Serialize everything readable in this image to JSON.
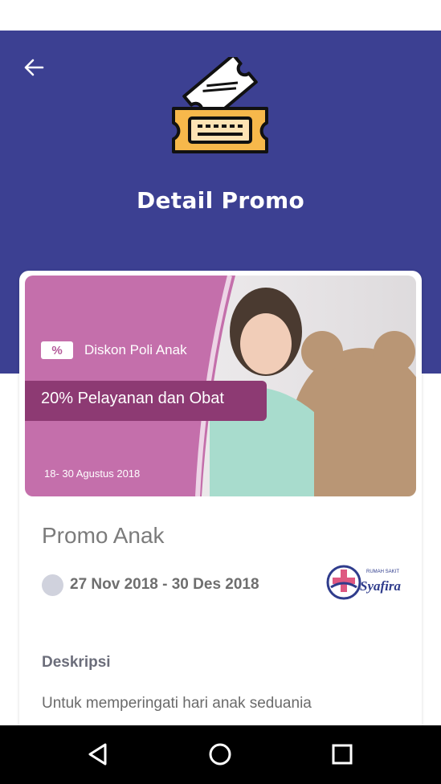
{
  "header": {
    "title": "Detail Promo",
    "back_icon": "arrow-left-icon",
    "header_icon": "ticket-icon",
    "bg_color": "#3c4092"
  },
  "banner": {
    "subtitle": "Diskon Poli Anak",
    "badge": "%",
    "main_text": "20% Pelayanan dan Obat",
    "date_text": "18- 30 Agustus 2018",
    "accent_color": "#c46fab"
  },
  "promo": {
    "title": "Promo Anak",
    "date_range": "27 Nov 2018 - 30 Des 2018",
    "hospital_logo_text": "RUMAH SAKIT",
    "hospital_name": "Syafira",
    "section_label": "Deskripsi",
    "description": "Untuk memperingati hari anak seduania"
  },
  "nav": {
    "back_icon": "triangle-back-icon",
    "home_icon": "circle-home-icon",
    "recents_icon": "square-recents-icon"
  }
}
